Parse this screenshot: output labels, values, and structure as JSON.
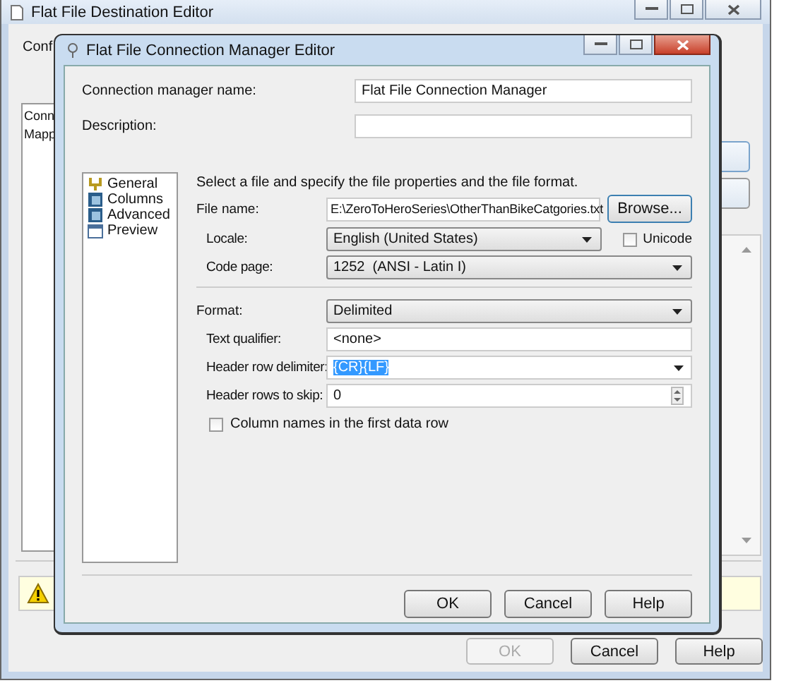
{
  "background_window": {
    "title": "Flat File Destination Editor",
    "config_label": "Conf",
    "list_items": [
      "Conn",
      "Mapp"
    ],
    "buttons": [
      {
        "label": "OK",
        "disabled": true
      },
      {
        "label": "Cancel",
        "disabled": false
      },
      {
        "label": "Help",
        "disabled": false
      }
    ]
  },
  "dialog": {
    "title": "Flat File Connection Manager Editor",
    "name_field": {
      "label": "Connection manager name:",
      "value": "Flat File Connection Manager"
    },
    "description_field": {
      "label": "Description:"
    },
    "pages": [
      {
        "label": "General",
        "kind": "tree"
      },
      {
        "label": "Columns",
        "kind": "grid"
      },
      {
        "label": "Advanced",
        "kind": "grid"
      },
      {
        "label": "Preview",
        "kind": "window"
      }
    ],
    "instruction": "Select a file and specify the file properties and the file format.",
    "file_name": {
      "label": "File name:",
      "value": "E:\\ZeroToHeroSeries\\OtherThanBikeCatgories.txt"
    },
    "browse_button": "Browse...",
    "locale": {
      "label": "Locale:",
      "value": "English (United States)"
    },
    "unicode": {
      "label": "Unicode",
      "checked": false
    },
    "code_page": {
      "label": "Code page:",
      "value": "1252  (ANSI - Latin I)"
    },
    "format": {
      "label": "Format:",
      "value": "Delimited"
    },
    "text_qualifier": {
      "label": "Text qualifier:",
      "value": "<none>"
    },
    "header_row_delimiter": {
      "label": "Header row delimiter:",
      "value": "{CR}{LF}",
      "selected": true
    },
    "header_rows_to_skip": {
      "label": "Header rows to skip:",
      "value": "0"
    },
    "column_names": {
      "label": "Column names in the first data row",
      "checked": false
    },
    "buttons": [
      "OK",
      "Cancel",
      "Help"
    ]
  }
}
